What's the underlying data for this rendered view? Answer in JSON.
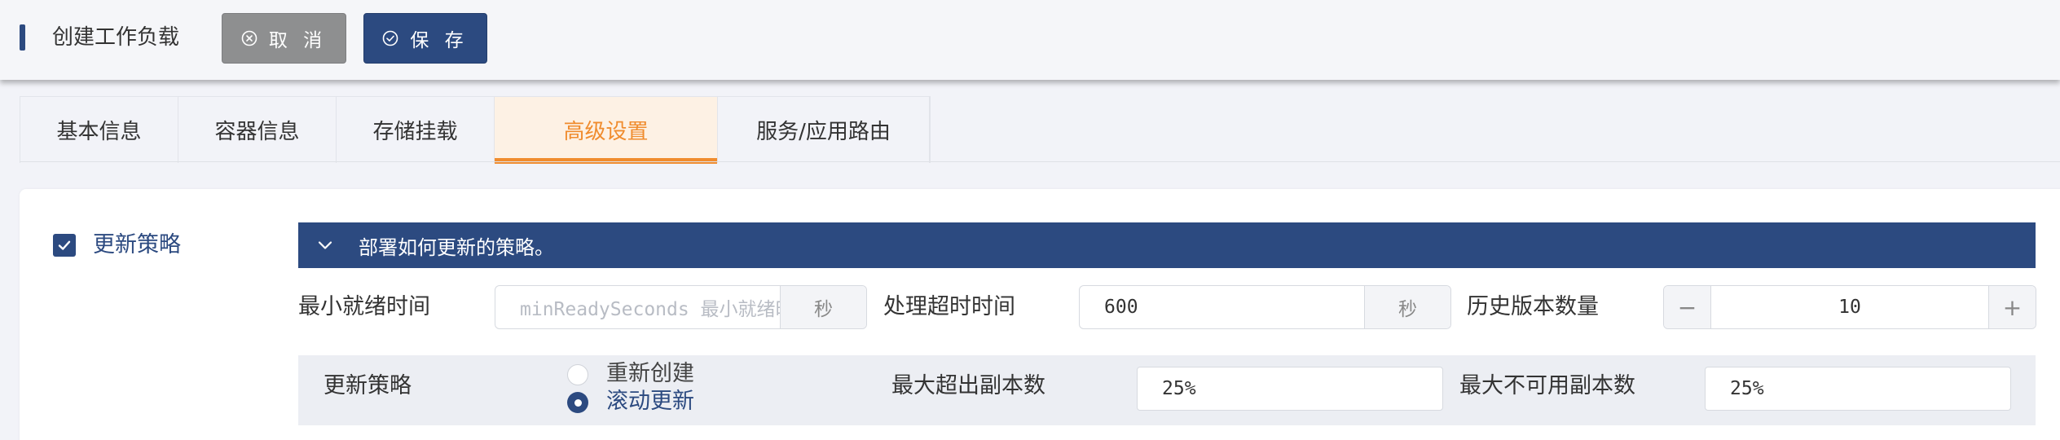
{
  "header": {
    "title": "创建工作负载",
    "cancel_label": "取 消",
    "save_label": "保 存"
  },
  "tabs": [
    {
      "label": "基本信息",
      "active": false
    },
    {
      "label": "容器信息",
      "active": false
    },
    {
      "label": "存储挂载",
      "active": false
    },
    {
      "label": "高级设置",
      "active": true
    },
    {
      "label": "服务/应用路由",
      "active": false
    }
  ],
  "update_strategy_section": {
    "checkbox_label": "更新策略",
    "checked": true,
    "banner_text": "部署如何更新的策略。",
    "min_ready": {
      "label": "最小就绪时间",
      "value": "",
      "placeholder": "minReadySeconds 最小就绪时间",
      "unit": "秒"
    },
    "timeout": {
      "label": "处理超时时间",
      "value": "600",
      "unit": "秒"
    },
    "history": {
      "label": "历史版本数量",
      "value": "10",
      "minus": "−",
      "plus": "+"
    },
    "strategy": {
      "label": "更新策略",
      "options": [
        "重新创建",
        "滚动更新"
      ],
      "selected": "滚动更新"
    },
    "max_surge": {
      "label": "最大超出副本数",
      "value": "25%"
    },
    "max_unavailable": {
      "label": "最大不可用副本数",
      "value": "25%"
    }
  },
  "colors": {
    "primary": "#2c4a80",
    "accent": "#f08c2e",
    "cancel": "#8e8f90"
  }
}
